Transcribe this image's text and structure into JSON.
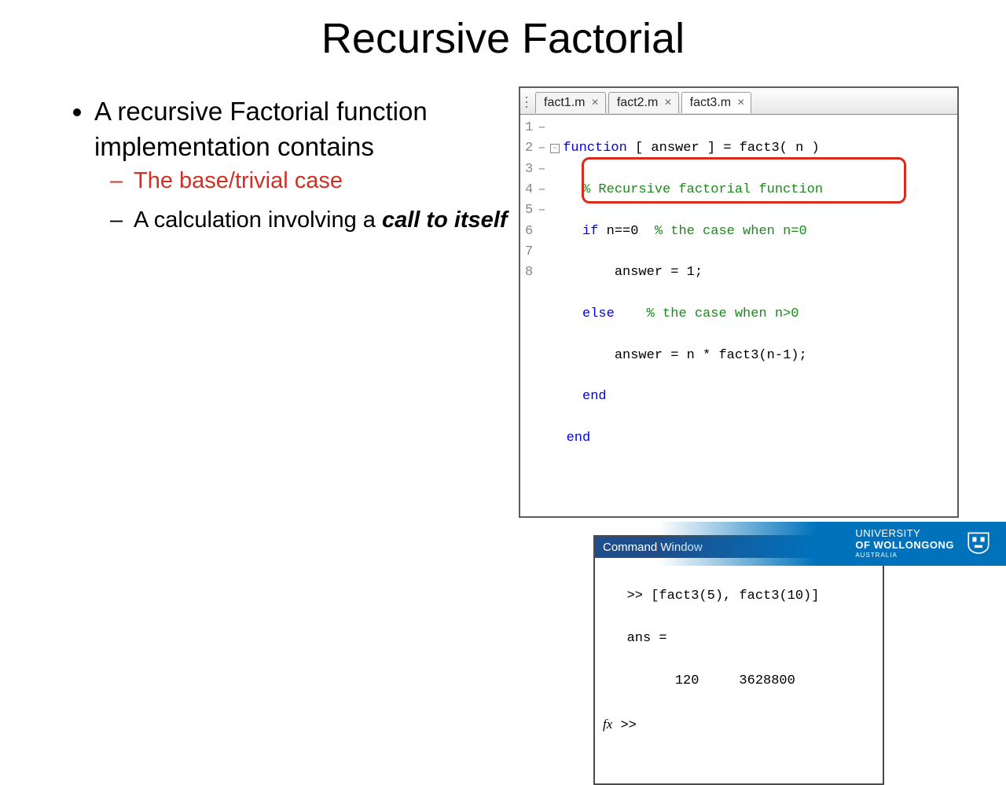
{
  "title": "Recursive Factorial",
  "bullets": {
    "main": "A recursive Factorial function implementation contains",
    "sub1": "The base/trivial case",
    "sub2_a": "A calculation involving a ",
    "sub2_b": "call to itself"
  },
  "tabs": [
    {
      "label": "fact1.m"
    },
    {
      "label": "fact2.m"
    },
    {
      "label": "fact3.m"
    }
  ],
  "code": {
    "numbers": [
      "1",
      "2",
      "3",
      "4",
      "5",
      "6",
      "7",
      "8"
    ],
    "breaks": [
      "",
      "",
      "–",
      "–",
      "–",
      "–",
      "–",
      ""
    ],
    "l1_kw": "function",
    "l1_rest": " [ answer ] = fact3( n )",
    "l2_comment": "% Recursive factorial function",
    "l3_if": "if",
    "l3_cond": " n==0  ",
    "l3_comment": "% the case when n=0",
    "l4": "answer = 1;",
    "l5_else": "else",
    "l5_sp": "    ",
    "l5_comment": "% the case when n>0",
    "l6": "answer = n * fact3(n-1);",
    "l7_end": "end",
    "l8_end": "end"
  },
  "cmd": {
    "title": "Command Window",
    "line1": ">> [fact3(5), fact3(10)]",
    "line2": "ans =",
    "line3": "         120     3628800",
    "fx": "fx",
    "prompt": " >>"
  },
  "footer": {
    "l1": "UNIVERSITY",
    "l2": "OF WOLLONGONG",
    "sub": "AUSTRALIA"
  }
}
